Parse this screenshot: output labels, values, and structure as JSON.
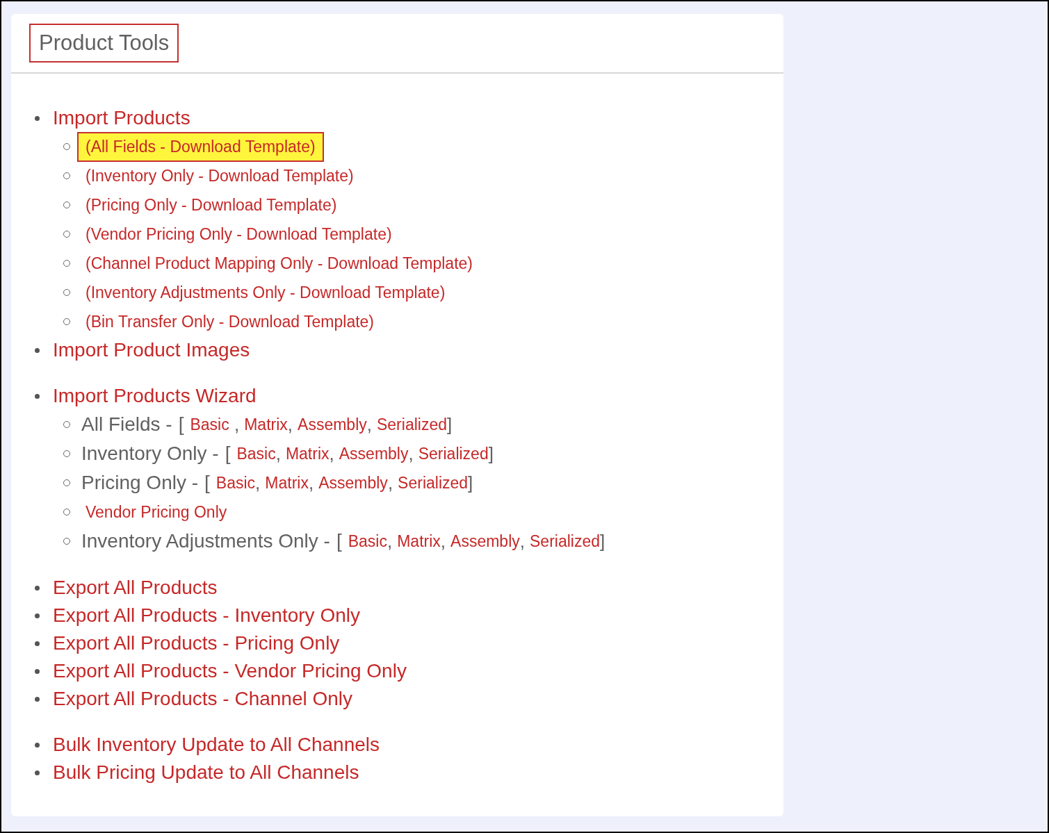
{
  "panel": {
    "title": "Product Tools",
    "title_highlighted": true
  },
  "sections": [
    {
      "items": [
        {
          "label": "Import Products",
          "children": [
            {
              "kind": "link",
              "label": "(All Fields - Download Template)",
              "highlighted": true
            },
            {
              "kind": "link",
              "label": "(Inventory Only - Download Template)",
              "highlighted": false
            },
            {
              "kind": "link",
              "label": "(Pricing Only - Download Template)",
              "highlighted": false
            },
            {
              "kind": "link",
              "label": "(Vendor Pricing Only - Download Template)",
              "highlighted": false
            },
            {
              "kind": "link",
              "label": "(Channel Product Mapping Only - Download Template)",
              "highlighted": false
            },
            {
              "kind": "link",
              "label": "(Inventory Adjustments Only - Download Template)",
              "highlighted": false
            },
            {
              "kind": "link",
              "label": "(Bin Transfer Only - Download Template)",
              "highlighted": false
            }
          ]
        },
        {
          "label": "Import Product Images"
        }
      ]
    },
    {
      "items": [
        {
          "label": "Import Products Wizard",
          "children": [
            {
              "kind": "options",
              "label": "All Fields -",
              "open": "[",
              "options": [
                {
                  "label": "Basic",
                  "after": " ,"
                },
                {
                  "label": "Matrix",
                  "after": ","
                },
                {
                  "label": "Assembly",
                  "after": ","
                },
                {
                  "label": "Serialized",
                  "after": "]"
                }
              ]
            },
            {
              "kind": "options",
              "label": "Inventory Only -",
              "open": "[",
              "options": [
                {
                  "label": "Basic",
                  "after": ","
                },
                {
                  "label": "Matrix",
                  "after": ","
                },
                {
                  "label": "Assembly",
                  "after": ","
                },
                {
                  "label": "Serialized",
                  "after": "]"
                }
              ]
            },
            {
              "kind": "options",
              "label": "Pricing Only -",
              "open": "[",
              "options": [
                {
                  "label": "Basic",
                  "after": ","
                },
                {
                  "label": "Matrix",
                  "after": ","
                },
                {
                  "label": "Assembly",
                  "after": ","
                },
                {
                  "label": "Serialized",
                  "after": "]"
                }
              ]
            },
            {
              "kind": "link",
              "label": "Vendor Pricing Only",
              "highlighted": false
            },
            {
              "kind": "options",
              "label": "Inventory Adjustments Only -",
              "open": "[",
              "options": [
                {
                  "label": "Basic",
                  "after": ","
                },
                {
                  "label": "Matrix",
                  "after": ","
                },
                {
                  "label": "Assembly",
                  "after": ","
                },
                {
                  "label": "Serialized",
                  "after": "]"
                }
              ]
            }
          ]
        }
      ]
    },
    {
      "items": [
        {
          "label": "Export All Products"
        },
        {
          "label": "Export All Products - Inventory Only"
        },
        {
          "label": "Export All Products - Pricing Only"
        },
        {
          "label": "Export All Products - Vendor Pricing Only"
        },
        {
          "label": "Export All Products - Channel Only"
        }
      ]
    },
    {
      "items": [
        {
          "label": "Bulk Inventory Update to All Channels"
        },
        {
          "label": "Bulk Pricing Update to All Channels"
        }
      ]
    }
  ]
}
